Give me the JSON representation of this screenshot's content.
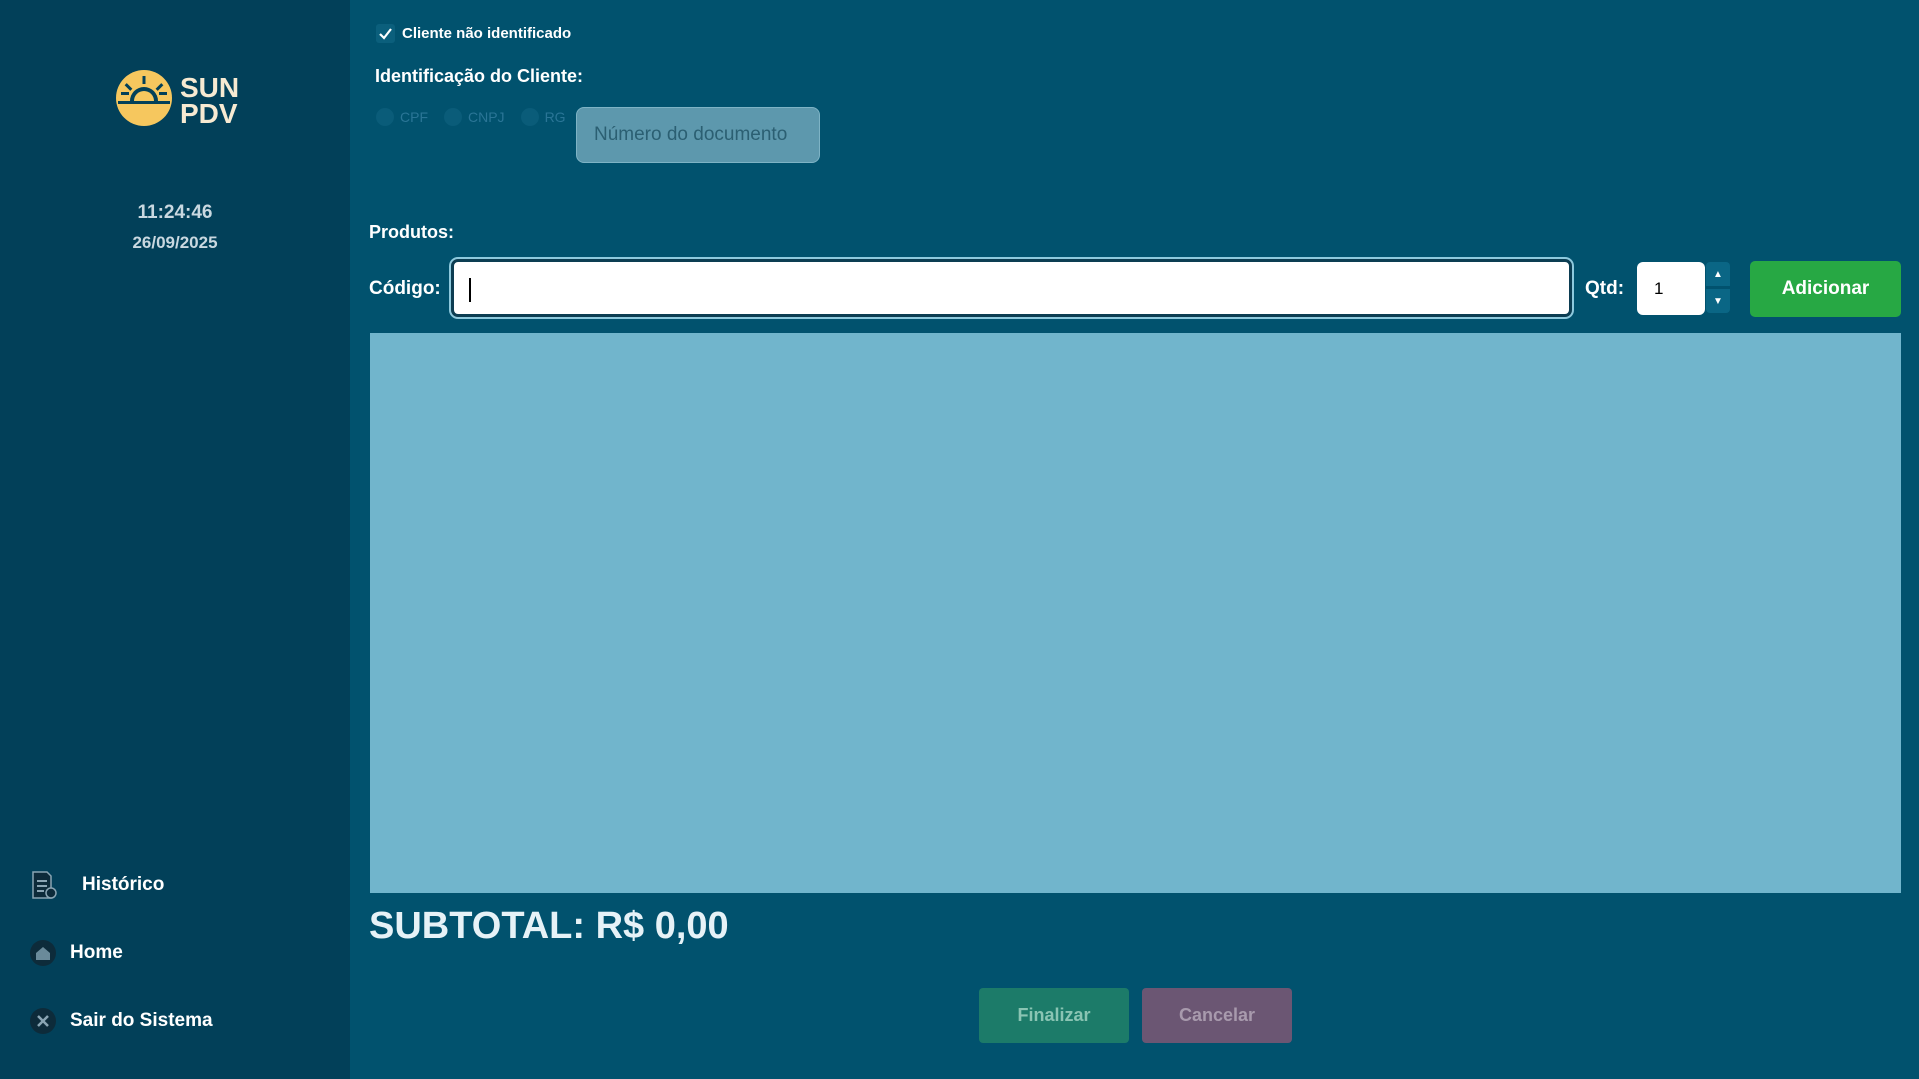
{
  "sidebar": {
    "logo": {
      "line1": "SUN",
      "line2": "PDV",
      "icon": "sun-icon"
    },
    "time": "11:24:46",
    "date": "26/09/2025",
    "nav": [
      {
        "label": "Histórico",
        "icon": "receipt-icon"
      },
      {
        "label": "Home",
        "icon": "home-icon"
      },
      {
        "label": "Sair do Sistema",
        "icon": "close-icon"
      }
    ]
  },
  "client": {
    "unidentified_label": "Cliente não identificado",
    "unidentified_checked": true,
    "title": "Identificação do Cliente:",
    "doc_types": [
      "CPF",
      "CNPJ",
      "RG"
    ],
    "doc_placeholder": "Número do documento"
  },
  "products": {
    "title": "Produtos:",
    "code_label": "Código:",
    "code_value": "",
    "qty_label": "Qtd:",
    "qty_value": "1",
    "add_label": "Adicionar"
  },
  "subtotal": "SUBTOTAL: R$ 0,00",
  "actions": {
    "finalize": "Finalizar",
    "cancel": "Cancelar"
  },
  "colors": {
    "background": "#01526e",
    "sidebar": "#024059",
    "accent_green": "#27a844",
    "logo_yellow": "#f6c75e",
    "list_bg": "#71b5cc"
  }
}
